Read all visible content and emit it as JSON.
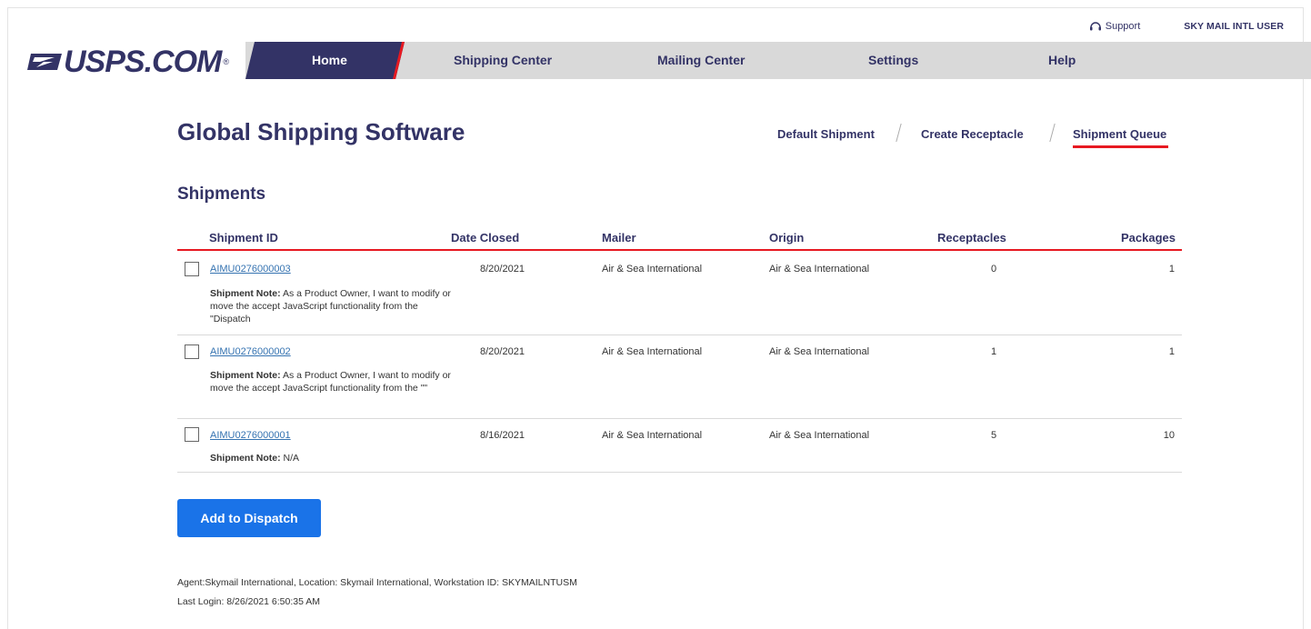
{
  "header": {
    "support_label": "Support",
    "user_label": "SKY MAIL INTL USER",
    "logo_text": "USPS.COM",
    "logo_reg": "®"
  },
  "nav": {
    "items": [
      "Home",
      "Shipping Center",
      "Mailing Center",
      "Settings",
      "Help"
    ],
    "active": "Home"
  },
  "page": {
    "title": "Global Shipping Software",
    "subnav": [
      "Default Shipment",
      "Create Receptacle",
      "Shipment Queue"
    ],
    "subnav_active": "Shipment Queue",
    "section_title": "Shipments"
  },
  "table": {
    "columns": [
      "Shipment ID",
      "Date Closed",
      "Mailer",
      "Origin",
      "Receptacles",
      "Packages"
    ],
    "note_label": "Shipment Note:",
    "rows": [
      {
        "id": "AIMU0276000003",
        "date_closed": "8/20/2021",
        "mailer": "Air & Sea International",
        "origin": "Air & Sea International",
        "receptacles": "0",
        "packages": "1",
        "note": "As a Product Owner, I want to modify or move the accept JavaScript functionality from the \"Dispatch"
      },
      {
        "id": "AIMU0276000002",
        "date_closed": "8/20/2021",
        "mailer": "Air & Sea International",
        "origin": "Air & Sea International",
        "receptacles": "1",
        "packages": "1",
        "note": "As a Product Owner, I want to modify or move the accept JavaScript functionality from the \"\""
      },
      {
        "id": "AIMU0276000001",
        "date_closed": "8/16/2021",
        "mailer": "Air & Sea International",
        "origin": "Air & Sea International",
        "receptacles": "5",
        "packages": "10",
        "note": "N/A"
      }
    ]
  },
  "actions": {
    "add_to_dispatch": "Add to Dispatch"
  },
  "footer": {
    "agent_line": "Agent:Skymail International, Location: Skymail International, Workstation ID: SKYMAILNTUSM",
    "last_login": "Last Login: 8/26/2021 6:50:35 AM"
  },
  "colors": {
    "navy": "#333366",
    "red": "#e71921",
    "button_blue": "#1a73e8",
    "link_blue": "#3573b1"
  }
}
